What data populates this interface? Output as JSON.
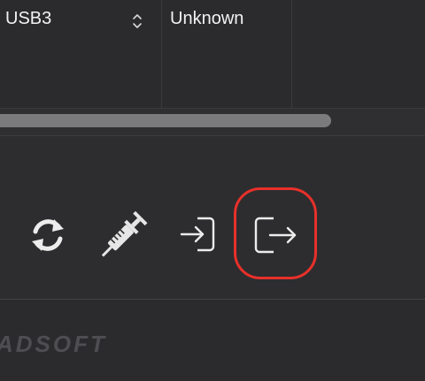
{
  "table": {
    "row": {
      "interface": "USB3",
      "status": "Unknown"
    }
  },
  "toolbar": {
    "buttons": [
      {
        "icon": "refresh-icon"
      },
      {
        "icon": "syringe-icon"
      },
      {
        "icon": "import-icon"
      },
      {
        "icon": "export-icon",
        "highlighted": true
      }
    ],
    "highlight_color": "#e8302a"
  },
  "footer": {
    "brand": "LEADSOFT"
  }
}
